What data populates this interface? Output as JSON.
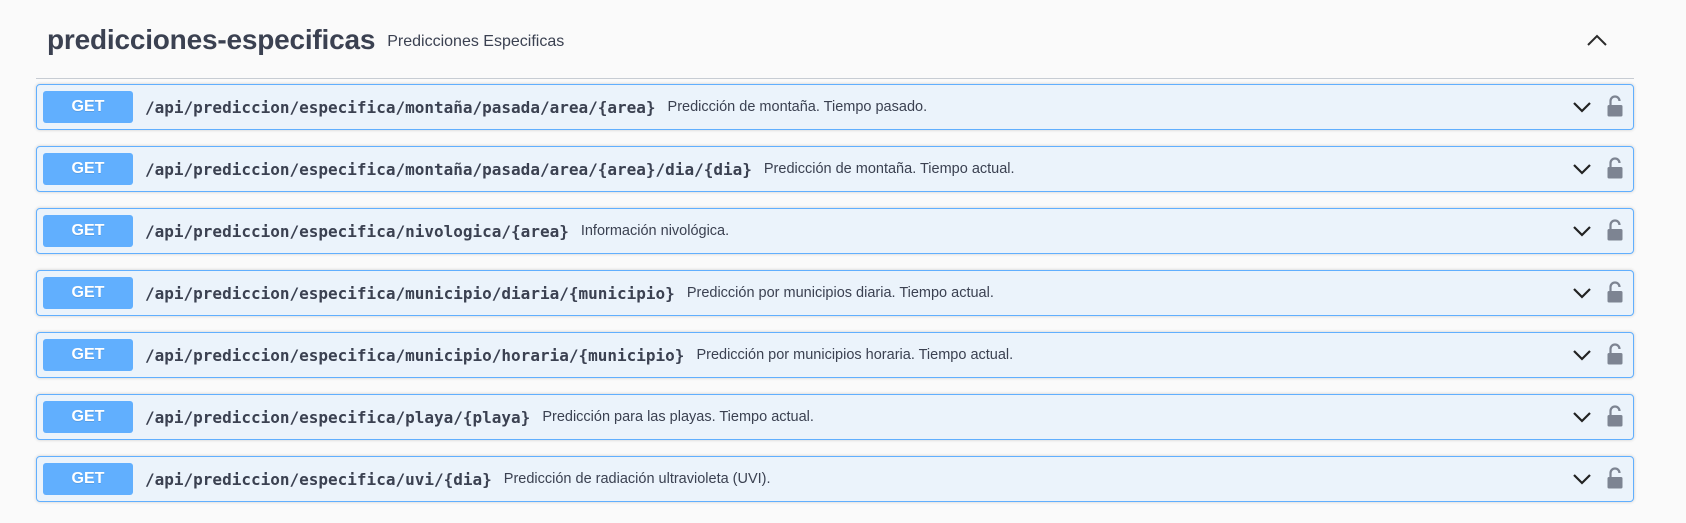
{
  "tag": {
    "name": "predicciones-especificas",
    "description": "Predicciones Especificas",
    "toggle_icon": "chevron-up-icon"
  },
  "colors": {
    "get_method": "#61affe",
    "get_background": "#ebf3fb",
    "get_border": "#61affe",
    "text": "#3b4151",
    "icon": "#7d8492"
  },
  "operations": [
    {
      "method": "GET",
      "path": "/api/prediccion/especifica/montaña/pasada/area/{area}",
      "summary": "Predicción de montaña. Tiempo pasado."
    },
    {
      "method": "GET",
      "path": "/api/prediccion/especifica/montaña/pasada/area/{area}/dia/{dia}",
      "summary": "Predicción de montaña. Tiempo actual."
    },
    {
      "method": "GET",
      "path": "/api/prediccion/especifica/nivologica/{area}",
      "summary": "Información nivológica."
    },
    {
      "method": "GET",
      "path": "/api/prediccion/especifica/municipio/diaria/{municipio}",
      "summary": "Predicción por municipios diaria. Tiempo actual."
    },
    {
      "method": "GET",
      "path": "/api/prediccion/especifica/municipio/horaria/{municipio}",
      "summary": "Predicción por municipios horaria. Tiempo actual."
    },
    {
      "method": "GET",
      "path": "/api/prediccion/especifica/playa/{playa}",
      "summary": "Predicción para las playas. Tiempo actual."
    },
    {
      "method": "GET",
      "path": "/api/prediccion/especifica/uvi/{dia}",
      "summary": "Predicción de radiación ultravioleta (UVI)."
    }
  ]
}
